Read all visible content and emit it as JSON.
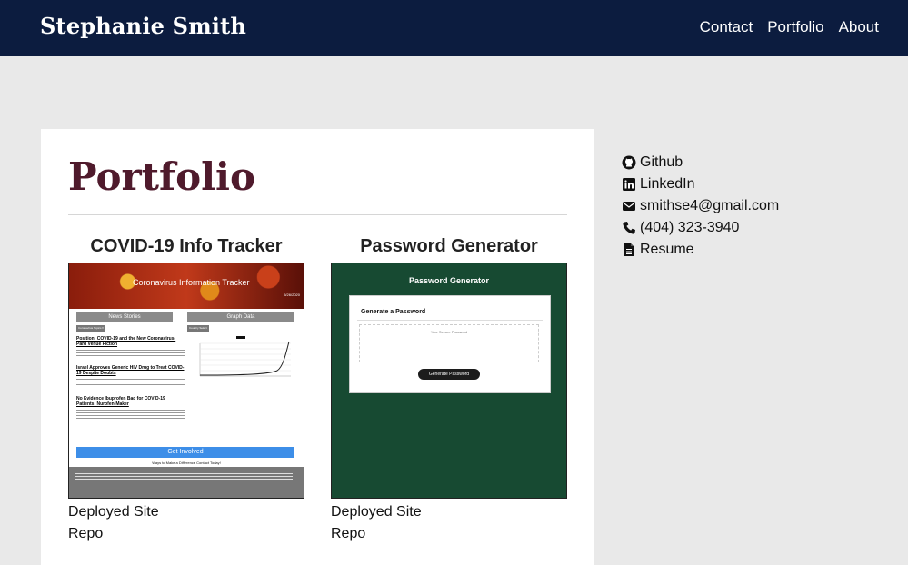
{
  "nav": {
    "brand": "Stephanie Smith",
    "links": [
      {
        "label": "Contact",
        "icon": null
      },
      {
        "label": "Portfolio",
        "icon": null
      },
      {
        "label": "About",
        "icon": null
      }
    ],
    "background": "#0c1c3f"
  },
  "main": {
    "title": "Portfolio",
    "title_color": "#4f1a2c",
    "projects": [
      {
        "title": "COVID-19 Info Tracker",
        "links": [
          "Deployed Site",
          "Repo"
        ],
        "thumbnail": {
          "banner_title": "Coronavirus Information Tracker",
          "banner_date": "5/26/2020",
          "left_heading": "News Stories",
          "right_heading": "Graph Data",
          "topic_button": "Coronavirus Topics ▾",
          "country_button": "Country Select",
          "news": [
            "Position: COVID-19 and the New Coronavirus-Pard Venue Fiction",
            "Israel Approves Generic HIV Drug to Treat COVID-19 Despite Doubts",
            "No Evidence Ibuprofen Bad for COVID-19 Patients: Nurofen-Maker"
          ],
          "cta": "Get Involved",
          "ways": "Ways to Make a Difference Contact Today!"
        }
      },
      {
        "title": "Password Generator",
        "links": [
          "Deployed Site",
          "Repo"
        ],
        "thumbnail": {
          "app_title": "Password Generator",
          "card_title": "Generate a Password",
          "placeholder": "Your Secure Password",
          "button": "Generate Password"
        }
      }
    ]
  },
  "sidebar": {
    "items": [
      {
        "label": "Github",
        "icon": "github-icon"
      },
      {
        "label": "LinkedIn",
        "icon": "linkedin-icon"
      },
      {
        "label": "smithse4@gmail.com",
        "icon": "envelope-icon"
      },
      {
        "label": "(404) 323-3940",
        "icon": "phone-icon"
      },
      {
        "label": "Resume",
        "icon": "document-icon"
      }
    ]
  }
}
